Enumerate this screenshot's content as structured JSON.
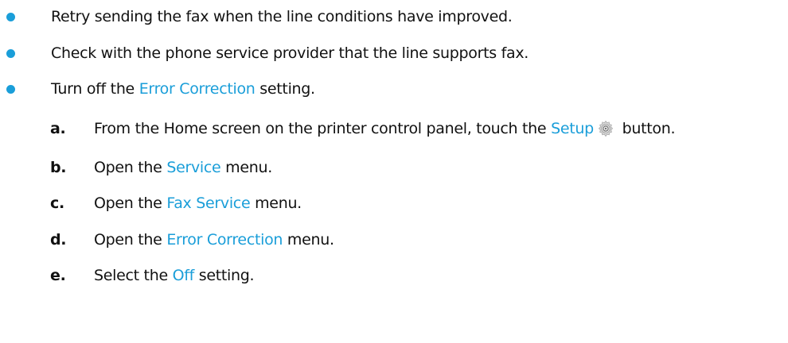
{
  "bullets": [
    {
      "text": "Retry sending the fax when the line conditions have improved."
    },
    {
      "text": "Check with the phone service provider that the line supports fax."
    },
    {
      "pre": "Turn off the ",
      "link": "Error Correction",
      "post": " setting."
    }
  ],
  "steps": [
    {
      "letter": "a.",
      "pre": "From the Home screen on the printer control panel, touch the ",
      "link": "Setup",
      "post": " button.",
      "icon": "gear-icon"
    },
    {
      "letter": "b.",
      "pre": "Open the ",
      "link": "Service",
      "post": " menu."
    },
    {
      "letter": "c.",
      "pre": "Open the ",
      "link": "Fax Service",
      "post": " menu."
    },
    {
      "letter": "d.",
      "pre": "Open the ",
      "link": "Error Correction",
      "post": " menu."
    },
    {
      "letter": "e.",
      "pre": "Select the ",
      "link": "Off",
      "post": " setting."
    }
  ],
  "colors": {
    "bullet": "#1a9ed9",
    "link": "#1a9ed9",
    "text": "#111111"
  }
}
